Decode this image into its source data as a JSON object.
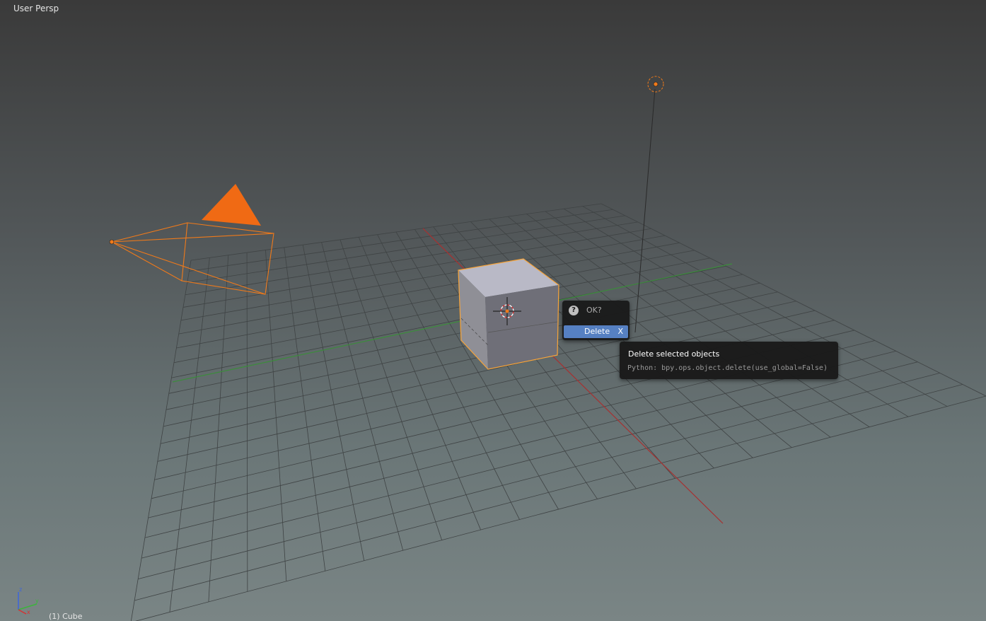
{
  "viewport": {
    "view_name": "User Persp",
    "object_info": "(1) Cube",
    "axis_gizmo": {
      "labels": [
        "z",
        "y",
        "x"
      ],
      "colors": {
        "x": "#d63232",
        "y": "#3cb43c",
        "z": "#3c64dc"
      }
    }
  },
  "scene": {
    "objects": [
      {
        "name": "camera",
        "icon": "camera-icon",
        "selected": true
      },
      {
        "name": "lamp",
        "icon": "lamp-icon",
        "selected": true
      },
      {
        "name": "cube",
        "icon": "cube-icon",
        "selected": true
      }
    ],
    "selection_color": "#f07a1a",
    "x_axis_color": "#a83030",
    "y_axis_color": "#3c8c3c"
  },
  "confirm_popup": {
    "icon": "question-icon",
    "icon_glyph": "?",
    "title": "OK?",
    "items": [
      {
        "label": "Delete",
        "shortcut": "X",
        "highlighted": true
      }
    ],
    "highlight_color": "#5680c2"
  },
  "tooltip": {
    "title": "Delete selected objects",
    "python": "Python: bpy.ops.object.delete(use_global=False)"
  }
}
